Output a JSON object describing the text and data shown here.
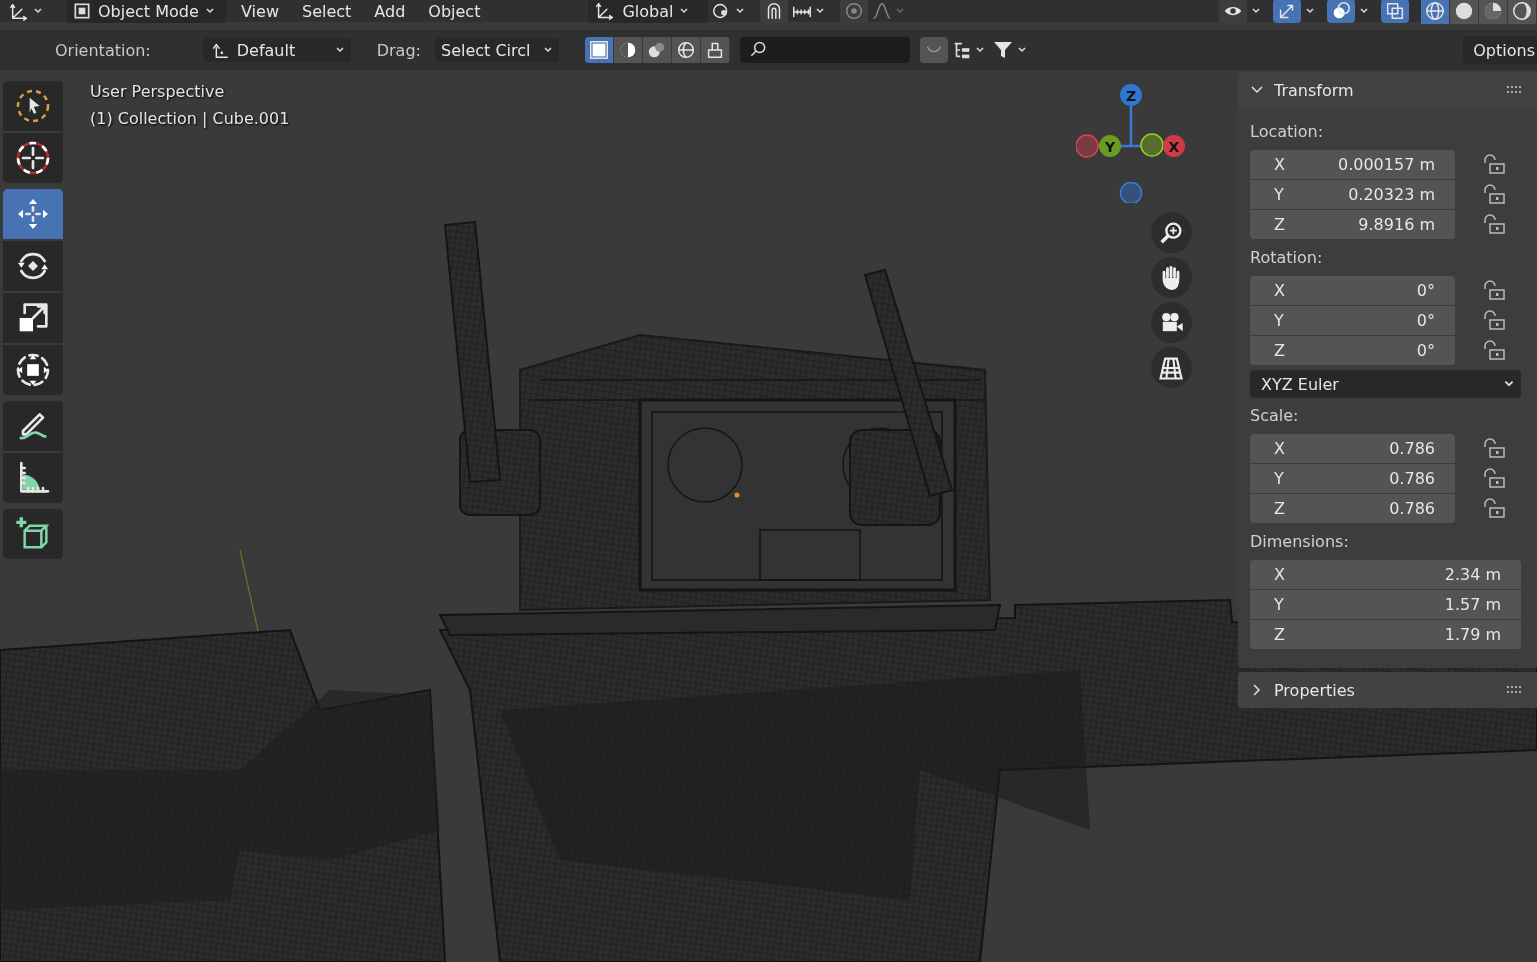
{
  "header": {
    "mode": "Object Mode",
    "menus": [
      "View",
      "Select",
      "Add",
      "Object"
    ],
    "orientation": "Global",
    "snap": {
      "on": false
    },
    "proportional_editing": {
      "on": false
    },
    "viewport_toggles": [
      {
        "kind": "visibility",
        "on": false
      },
      {
        "kind": "gizmos",
        "on": true
      },
      {
        "kind": "overlays",
        "on": true
      },
      {
        "kind": "xray",
        "on": true
      }
    ],
    "shading": [
      {
        "kind": "wireframe",
        "selected": true
      },
      {
        "kind": "solid",
        "selected": false
      },
      {
        "kind": "material",
        "selected": false
      },
      {
        "kind": "rendered",
        "selected": false
      }
    ]
  },
  "tool_settings": {
    "orientation_label": "Orientation:",
    "orientation_value": "Default",
    "drag_label": "Drag:",
    "drag_value": "Select Circl",
    "select_modes": [
      {
        "kind": "set",
        "selected": true
      },
      {
        "kind": "extend",
        "selected": false
      },
      {
        "kind": "subtract",
        "selected": false
      },
      {
        "kind": "invert",
        "selected": false
      },
      {
        "kind": "intersect",
        "selected": false
      }
    ],
    "options": "Options"
  },
  "viewport": {
    "view_name": "User Perspective",
    "object_info": "(1) Collection | Cube.001",
    "gizmo_axes": [
      "Z",
      "Y",
      "X"
    ],
    "tools": [
      [
        {
          "kind": "select",
          "selected": false
        },
        {
          "kind": "cursor",
          "selected": false
        }
      ],
      [
        {
          "kind": "move",
          "selected": true
        },
        {
          "kind": "rotate",
          "selected": false
        },
        {
          "kind": "scale",
          "selected": false
        },
        {
          "kind": "transform",
          "selected": false
        }
      ],
      [
        {
          "kind": "annotate",
          "selected": false
        },
        {
          "kind": "measure",
          "selected": false
        }
      ],
      [
        {
          "kind": "add_cube",
          "selected": false
        }
      ]
    ]
  },
  "transform": {
    "title": "Transform",
    "expanded": true,
    "groups": [
      {
        "label": "Location:",
        "lockable": true,
        "fields": [
          {
            "axis": "X",
            "value": "0.000157 m",
            "locked": false
          },
          {
            "axis": "Y",
            "value": "0.20323 m",
            "locked": false
          },
          {
            "axis": "Z",
            "value": "9.8916 m",
            "locked": false
          }
        ]
      },
      {
        "label": "Rotation:",
        "lockable": true,
        "mode": "XYZ Euler",
        "fields": [
          {
            "axis": "X",
            "value": "0°",
            "locked": false
          },
          {
            "axis": "Y",
            "value": "0°",
            "locked": false
          },
          {
            "axis": "Z",
            "value": "0°",
            "locked": false
          }
        ]
      },
      {
        "label": "Scale:",
        "lockable": true,
        "fields": [
          {
            "axis": "X",
            "value": "0.786",
            "locked": false
          },
          {
            "axis": "Y",
            "value": "0.786",
            "locked": false
          },
          {
            "axis": "Z",
            "value": "0.786",
            "locked": false
          }
        ]
      },
      {
        "label": "Dimensions:",
        "lockable": false,
        "fields": [
          {
            "axis": "X",
            "value": "2.34 m"
          },
          {
            "axis": "Y",
            "value": "1.57 m"
          },
          {
            "axis": "Z",
            "value": "1.79 m"
          }
        ]
      }
    ]
  },
  "properties": {
    "title": "Properties",
    "expanded": false
  }
}
